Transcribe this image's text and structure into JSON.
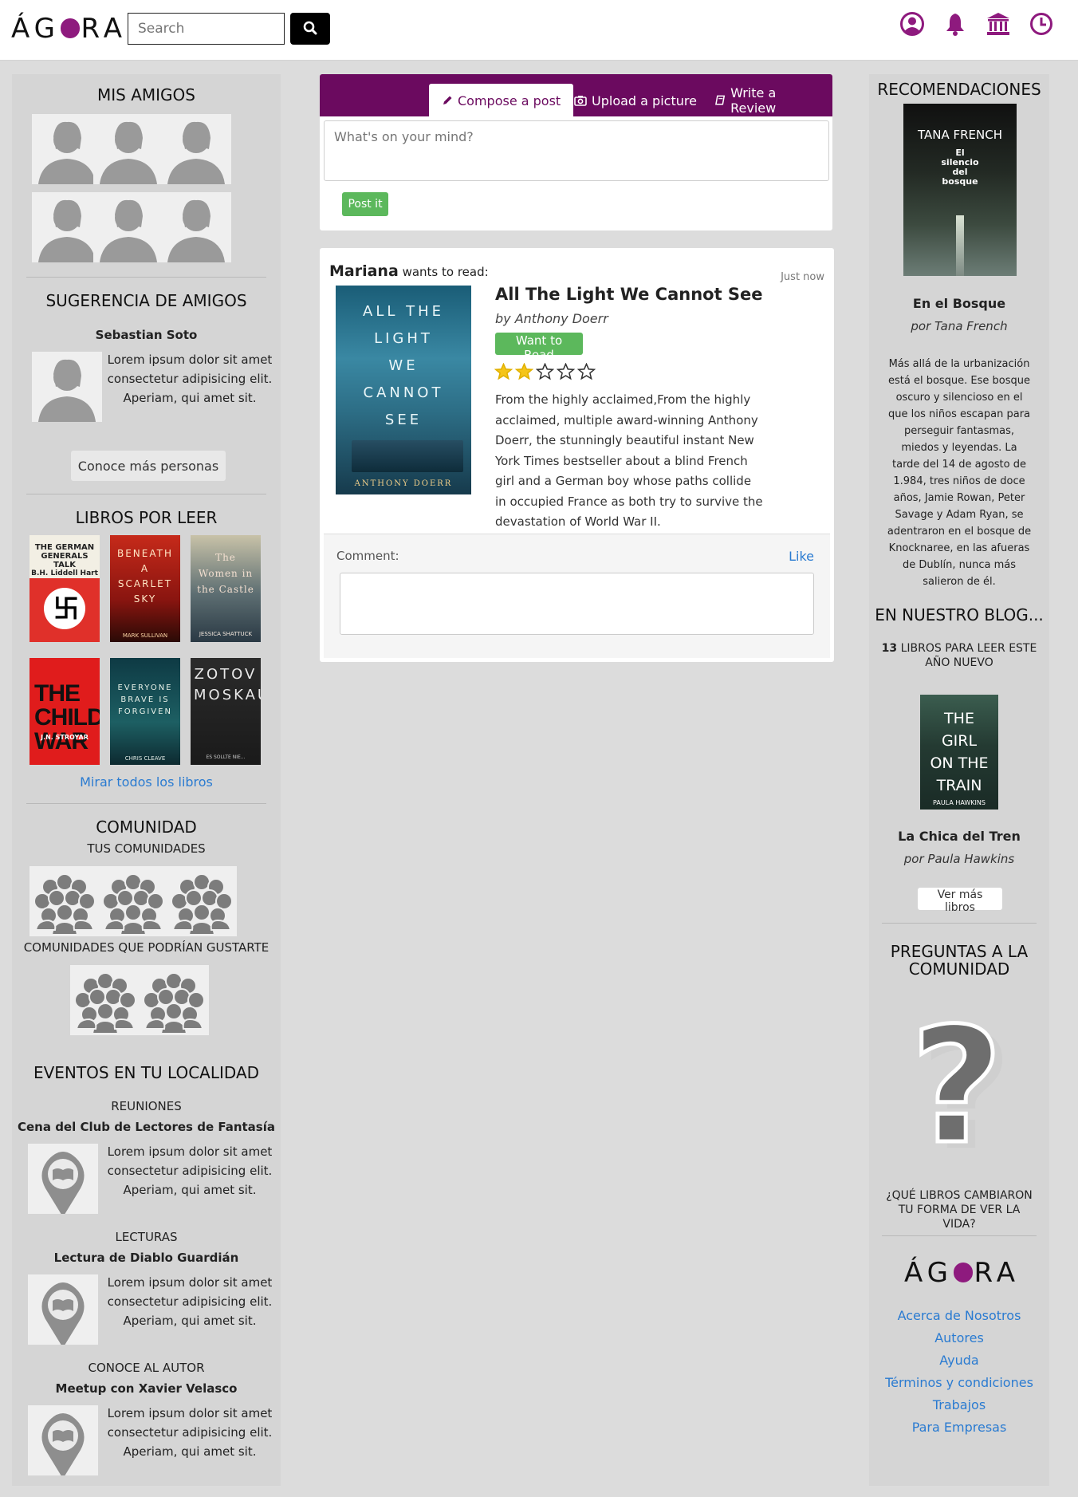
{
  "header": {
    "logo_text": "ÁG RA",
    "search_placeholder": "Search",
    "accent_color": "#8e1a7e",
    "icons": [
      "user-circle-icon",
      "bell-icon",
      "bank-icon",
      "clock-icon"
    ]
  },
  "left": {
    "friends_title": "MIS AMIGOS",
    "suggest_title": "SUGERENCIA DE AMIGOS",
    "suggest_name": "Sebastian Soto",
    "suggest_text": "Lorem ipsum dolor sit amet consectetur adipisicing elit. Aperiam, qui amet sit.",
    "more_people": "Conoce más personas",
    "books_title": "LIBROS POR LEER",
    "books": [
      {
        "title": "THE GERMAN GENERALS TALK",
        "author": "B.H. Liddell Hart"
      },
      {
        "title": "BENEATH A SCARLET SKY",
        "author": "MARK SULLIVAN"
      },
      {
        "title": "The Women in the Castle",
        "author": "JESSICA SHATTUCK"
      },
      {
        "title": "THE CHILDREN'S WAR",
        "author": "J.N. STROYAR"
      },
      {
        "title": "EVERYONE BRAVE IS FORGIVEN",
        "author": "CHRIS CLEAVE"
      },
      {
        "title": "ZOTOV MOSKAU",
        "author": "ES SOLLTE NIE..."
      }
    ],
    "all_books_link": "Mirar todos los libros",
    "community_title": "COMUNIDAD",
    "your_communities": "TUS COMUNIDADES",
    "suggested_communities": "COMUNIDADES QUE PODRÍAN GUSTARTE",
    "events_title": "EVENTOS EN TU LOCALIDAD",
    "events": [
      {
        "category": "REUNIONES",
        "name": "Cena del Club de Lectores de Fantasía",
        "text": "Lorem ipsum dolor sit amet consectetur adipisicing elit. Aperiam, qui amet sit."
      },
      {
        "category": "LECTURAS",
        "name": "Lectura de Diablo Guardián",
        "text": "Lorem ipsum dolor sit amet consectetur adipisicing elit. Aperiam, qui amet sit."
      },
      {
        "category": "CONOCE AL AUTOR",
        "name": "Meetup con Xavier Velasco",
        "text": "Lorem ipsum dolor sit amet consectetur adipisicing elit. Aperiam, qui amet sit."
      }
    ]
  },
  "composer": {
    "tabs": [
      "Compose a post",
      "Upload a picture",
      "Write a Review"
    ],
    "placeholder": "What's on your mind?",
    "post_button": "Post it",
    "header_color": "#6b0a5f"
  },
  "post": {
    "user": "Mariana",
    "action": "wants to read:",
    "time": "Just now",
    "cover_lines": [
      "ALL THE",
      "LIGHT",
      "WE",
      "CANNOT",
      "SEE"
    ],
    "cover_author": "ANTHONY DOERR",
    "book_title": "All The Light We Cannot See",
    "book_author": "by Anthony Doerr",
    "status_button": "Want to Read",
    "rating": 2,
    "rating_max": 5,
    "description": "From the highly acclaimed,From the highly acclaimed, multiple award-winning Anthony Doerr, the stunningly beautiful instant New York Times bestseller about a blind French girl and a German boy whose paths collide in occupied France as both try to survive the devastation of World War II.",
    "comment_label": "Comment:",
    "like": "Like"
  },
  "right": {
    "rec_title": "RECOMENDACIONES",
    "rec_cover_author": "TANA FRENCH",
    "rec_cover_title": "El silencio del bosque",
    "rec_book": "En el Bosque",
    "rec_author": "por Tana French",
    "rec_text": "Más allá de la urbanización está el bosque. Ese bosque oscuro y silencioso en el que los niños escapan para perseguir fantasmas, miedos y leyendas. La tarde del 14 de agosto de 1.984, tres niños de doce años, Jamie Rowan, Peter Savage y Adam Ryan, se adentraron en el bosque de Knocknaree, en las afueras de Dublín, nunca más salieron de él.",
    "blog_title": "EN NUESTRO BLOG...",
    "blog_count": "13",
    "blog_post": "LIBROS PARA LEER ESTE AÑO NUEVO",
    "blog_cover_lines": [
      "THE",
      "GIRL",
      "ON THE",
      "TRAIN"
    ],
    "blog_cover_author": "PAULA HAWKINS",
    "blog_book": "La Chica del Tren",
    "blog_author": "por Paula Hawkins",
    "more_books": "Ver más libros",
    "questions_title": "PREGUNTAS A LA COMUNIDAD",
    "question": "¿QUÉ LIBROS CAMBIARON TU FORMA DE VER LA VIDA?",
    "footer_links": [
      "Acerca de Nosotros",
      "Autores",
      "Ayuda",
      "Términos y condiciones",
      "Trabajos",
      "Para Empresas"
    ]
  }
}
